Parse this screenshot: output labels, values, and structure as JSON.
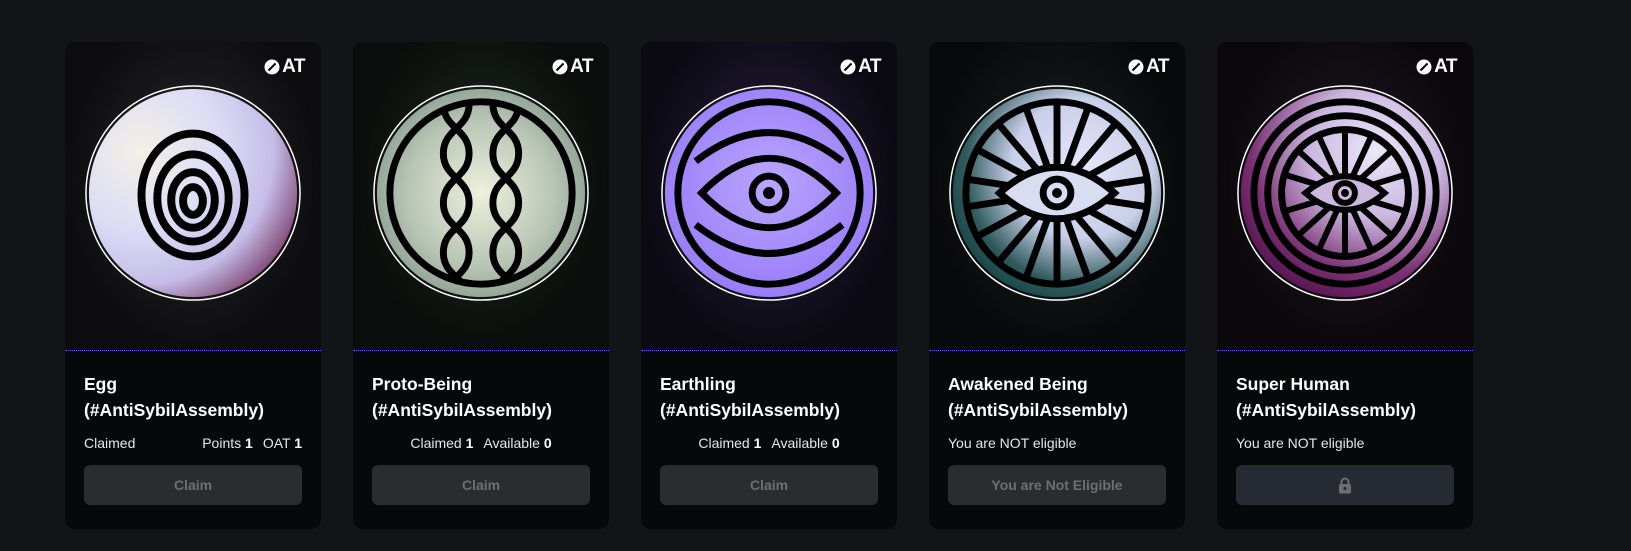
{
  "brand": {
    "logo_text": "AT"
  },
  "cards": [
    {
      "title_line1": "Egg",
      "title_line2": "(#AntiSybilAssembly)",
      "status": "Claimed",
      "points_label": "Points",
      "points_value": "1",
      "oat_label": "OAT",
      "oat_value": "1",
      "button_label": "Claim",
      "icon": "egg-rings-icon"
    },
    {
      "title_line1": "Proto-Being",
      "title_line2": "(#AntiSybilAssembly)",
      "claimed_label": "Claimed",
      "claimed_value": "1",
      "available_label": "Available",
      "available_value": "0",
      "button_label": "Claim",
      "icon": "dna-helix-icon"
    },
    {
      "title_line1": "Earthling",
      "title_line2": "(#AntiSybilAssembly)",
      "claimed_label": "Claimed",
      "claimed_value": "1",
      "available_label": "Available",
      "available_value": "0",
      "button_label": "Claim",
      "icon": "eye-arcs-icon"
    },
    {
      "title_line1": "Awakened Being",
      "title_line2": "(#AntiSybilAssembly)",
      "status": "You are NOT eligible",
      "button_label": "You are Not Eligible",
      "icon": "eye-rays-icon"
    },
    {
      "title_line1": "Super Human",
      "title_line2": "(#AntiSybilAssembly)",
      "status": "You are NOT eligible",
      "button_icon": "lock-icon",
      "icon": "eye-sunburst-icon"
    }
  ],
  "colors": {
    "page_bg": "#121418",
    "card_bg": "#07080a",
    "button_bg": "#2a2c30",
    "button_text": "#6c6e73",
    "divider": "#6b4cf0"
  }
}
